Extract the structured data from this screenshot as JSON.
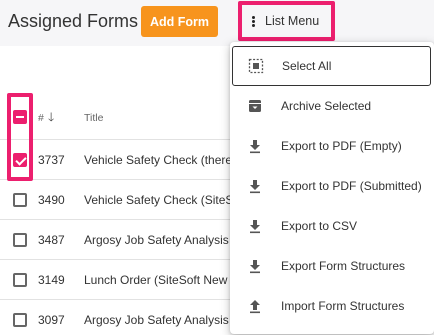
{
  "header": {
    "title": "Assigned Forms",
    "add_form_label": "Add Form",
    "list_menu_label": "List Menu"
  },
  "table": {
    "columns": {
      "num": "#",
      "title": "Title"
    },
    "rows": [
      {
        "num": "3737",
        "title": "Vehicle Safety Check (theres",
        "checked": true
      },
      {
        "num": "3490",
        "title": "Vehicle Safety Check (SiteSo",
        "checked": false
      },
      {
        "num": "3487",
        "title": "Argosy Job Safety Analysis (",
        "checked": false
      },
      {
        "num": "3149",
        "title": "Lunch Order (SiteSoft New Ze",
        "checked": false
      },
      {
        "num": "3097",
        "title": "Argosy Job Safety Analysis (",
        "checked": false
      }
    ]
  },
  "menu": {
    "items": [
      {
        "label": "Select All",
        "icon": "select-all-icon"
      },
      {
        "label": "Archive Selected",
        "icon": "archive-icon"
      },
      {
        "label": "Export to PDF (Empty)",
        "icon": "download-icon"
      },
      {
        "label": "Export to PDF (Submitted)",
        "icon": "download-icon"
      },
      {
        "label": "Export to CSV",
        "icon": "download-icon"
      },
      {
        "label": "Export Form Structures",
        "icon": "download-icon"
      },
      {
        "label": "Import Form Structures",
        "icon": "upload-icon"
      }
    ]
  },
  "colors": {
    "accent": "#f7941d",
    "highlight": "#ec1f6e"
  }
}
